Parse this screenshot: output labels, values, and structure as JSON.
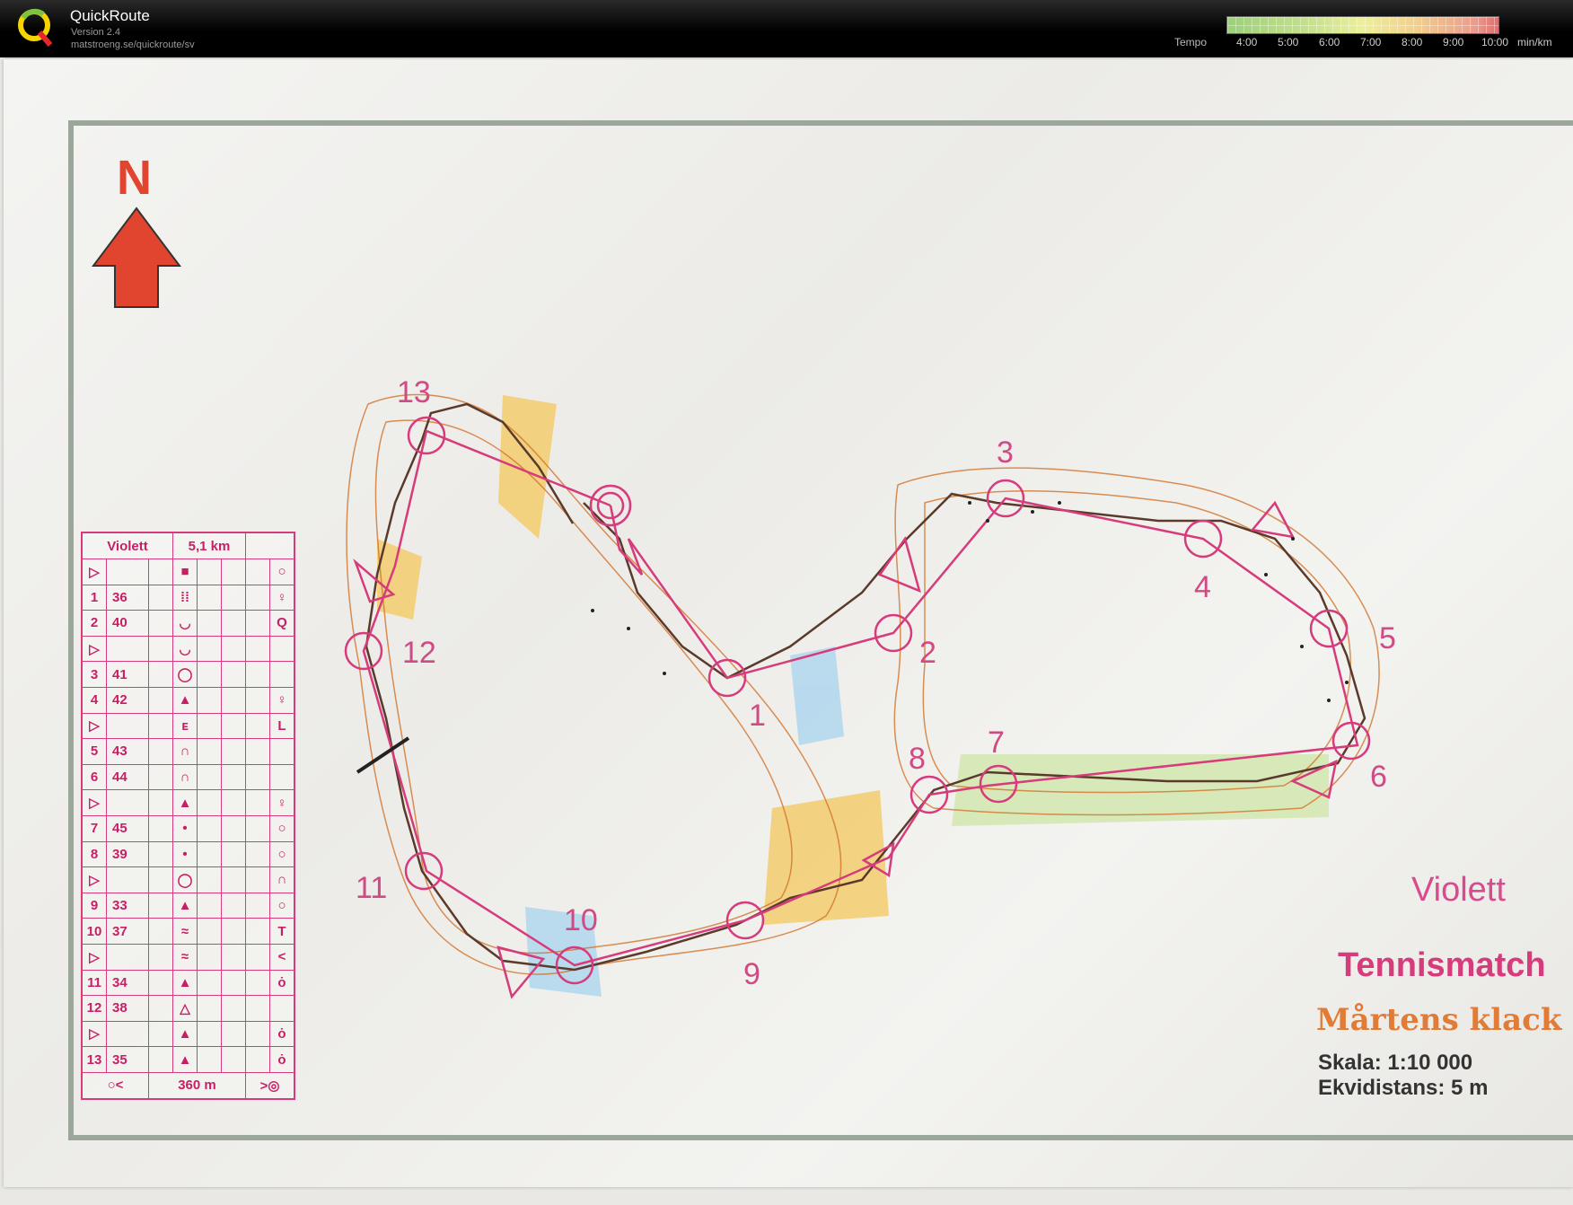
{
  "app": {
    "name": "QuickRoute",
    "version": "Version 2.4",
    "url": "matstroeng.se/quickroute/sv",
    "logo_icon": "quickroute-q-logo-icon"
  },
  "tempo_scale": {
    "label": "Tempo",
    "ticks": [
      "4:00",
      "5:00",
      "6:00",
      "7:00",
      "8:00",
      "9:00",
      "10:00"
    ],
    "unit": "min/km",
    "colors": [
      "#9bd07a",
      "#ecef9a",
      "#e36b6b"
    ]
  },
  "map": {
    "north_label": "N",
    "north_arrow_color": "#e2452f",
    "course_name": "Violett",
    "event_name": "Tennismatch",
    "area_name": "Mårtens klack",
    "scale": "Skala: 1:10 000",
    "contour_interval": "Ekvidistans: 5 m",
    "controls": [
      "1",
      "2",
      "3",
      "4",
      "5",
      "6",
      "7",
      "8",
      "9",
      "10",
      "11",
      "12",
      "13"
    ],
    "course_color": "#d63b7c"
  },
  "description_sheet": {
    "course": "Violett",
    "length": "5,1 km",
    "finish_distance": "360 m",
    "rows": [
      {
        "num": "",
        "code": ""
      },
      {
        "num": "1",
        "code": "36"
      },
      {
        "num": "2",
        "code": "40"
      },
      {
        "num": "",
        "code": ""
      },
      {
        "num": "3",
        "code": "41"
      },
      {
        "num": "4",
        "code": "42"
      },
      {
        "num": "",
        "code": ""
      },
      {
        "num": "5",
        "code": "43"
      },
      {
        "num": "6",
        "code": "44"
      },
      {
        "num": "",
        "code": ""
      },
      {
        "num": "7",
        "code": "45"
      },
      {
        "num": "8",
        "code": "39"
      },
      {
        "num": "",
        "code": ""
      },
      {
        "num": "9",
        "code": "33"
      },
      {
        "num": "10",
        "code": "37"
      },
      {
        "num": "",
        "code": ""
      },
      {
        "num": "11",
        "code": "34"
      },
      {
        "num": "12",
        "code": "38"
      },
      {
        "num": "",
        "code": ""
      },
      {
        "num": "13",
        "code": "35"
      }
    ]
  }
}
